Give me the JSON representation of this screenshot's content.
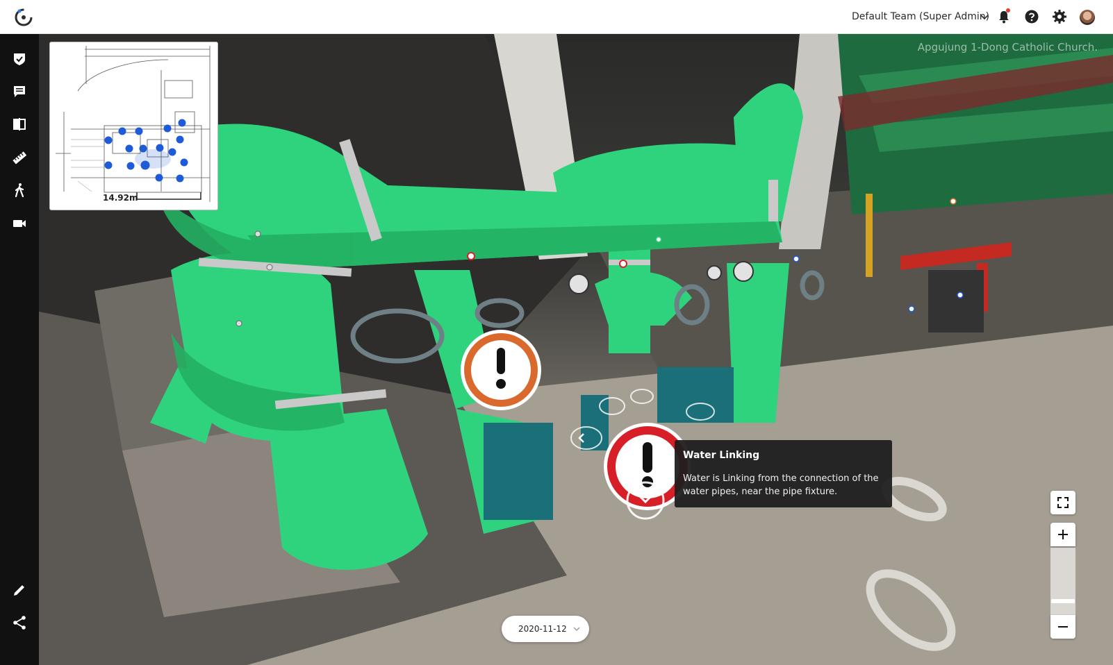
{
  "header": {
    "team_label": "Default Team (Super Admin)",
    "icons": [
      "logo-icon",
      "chevron-down-icon",
      "bell-icon",
      "help-icon",
      "gear-icon",
      "avatar"
    ]
  },
  "sidebar": {
    "items": [
      {
        "name": "checklist",
        "icon": "shield-check-icon"
      },
      {
        "name": "comments",
        "icon": "comment-icon"
      },
      {
        "name": "compare",
        "icon": "compare-icon"
      },
      {
        "name": "measure",
        "icon": "ruler-icon"
      },
      {
        "name": "walk",
        "icon": "walk-icon"
      },
      {
        "name": "video",
        "icon": "video-icon"
      },
      {
        "name": "edit",
        "icon": "pencil-icon"
      },
      {
        "name": "share",
        "icon": "share-icon"
      }
    ]
  },
  "viewer": {
    "watermark": "Apgujung 1-Dong Catholic Church.",
    "minimap": {
      "scale_label": "14.92m"
    },
    "tooltip": {
      "title": "Water Linking",
      "body": "Water is Linking from the connection of the water pipes, near the pipe fixture."
    },
    "date": "2020-11-12",
    "colors": {
      "pipe_green": "#2fd37e",
      "warning_orange": "#d9692d",
      "warning_red": "#d61f26",
      "minimap_dot": "#1e5bd6"
    }
  }
}
